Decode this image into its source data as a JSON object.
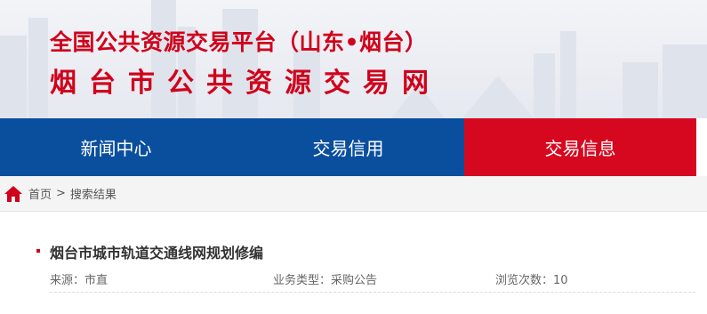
{
  "header": {
    "title_line1": "全国公共资源交易平台（山东•烟台）",
    "title_line2": "烟台市公共资源交易网"
  },
  "nav": {
    "items": [
      {
        "label": "新闻中心",
        "active": false
      },
      {
        "label": "交易信用",
        "active": false
      },
      {
        "label": "交易信息",
        "active": true
      }
    ]
  },
  "breadcrumb": {
    "home": "首页",
    "separator": ">",
    "current": "搜索结果"
  },
  "results": [
    {
      "title": "烟台市城市轨道交通线网规划修编",
      "source": "来源：市直",
      "type": "业务类型：采购公告",
      "views": "浏览次数：10"
    }
  ],
  "colors": {
    "brand_red": "#d0021b",
    "nav_blue": "#0a4f9e",
    "nav_active": "#d6081f"
  }
}
